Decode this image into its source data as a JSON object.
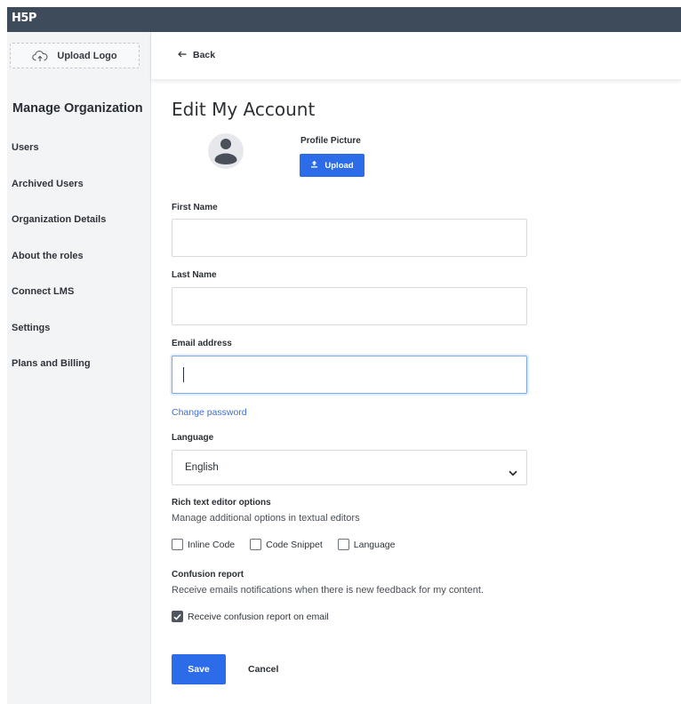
{
  "app": {
    "logo_text": "H5P"
  },
  "sidebar": {
    "upload_logo_label": "Upload Logo",
    "title": "Manage Organization",
    "items": [
      {
        "label": "Users"
      },
      {
        "label": "Archived Users"
      },
      {
        "label": "Organization Details"
      },
      {
        "label": "About the roles"
      },
      {
        "label": "Connect LMS"
      },
      {
        "label": "Settings"
      },
      {
        "label": "Plans and Billing"
      }
    ]
  },
  "header": {
    "back_label": "Back"
  },
  "form": {
    "title": "Edit My Account",
    "profile_picture_label": "Profile Picture",
    "upload_label": "Upload",
    "first_name": {
      "label": "First Name",
      "value": ""
    },
    "last_name": {
      "label": "Last Name",
      "value": ""
    },
    "email": {
      "label": "Email address",
      "value": ""
    },
    "change_password_label": "Change password",
    "language": {
      "label": "Language",
      "selected": "English"
    },
    "rich_text": {
      "title": "Rich text editor options",
      "description": "Manage additional options in textual editors",
      "options": [
        {
          "label": "Inline Code",
          "checked": false
        },
        {
          "label": "Code Snippet",
          "checked": false
        },
        {
          "label": "Language",
          "checked": false
        }
      ]
    },
    "confusion": {
      "title": "Confusion report",
      "description": "Receive emails notifications when there is new feedback for my content.",
      "checkbox_label": "Receive confusion report on email",
      "checked": true
    },
    "save_label": "Save",
    "cancel_label": "Cancel"
  },
  "colors": {
    "primary": "#2c6ce8",
    "topbar": "#3d4b5a",
    "sidebar_bg": "#f3f4f6",
    "link": "#3a6fd6"
  }
}
